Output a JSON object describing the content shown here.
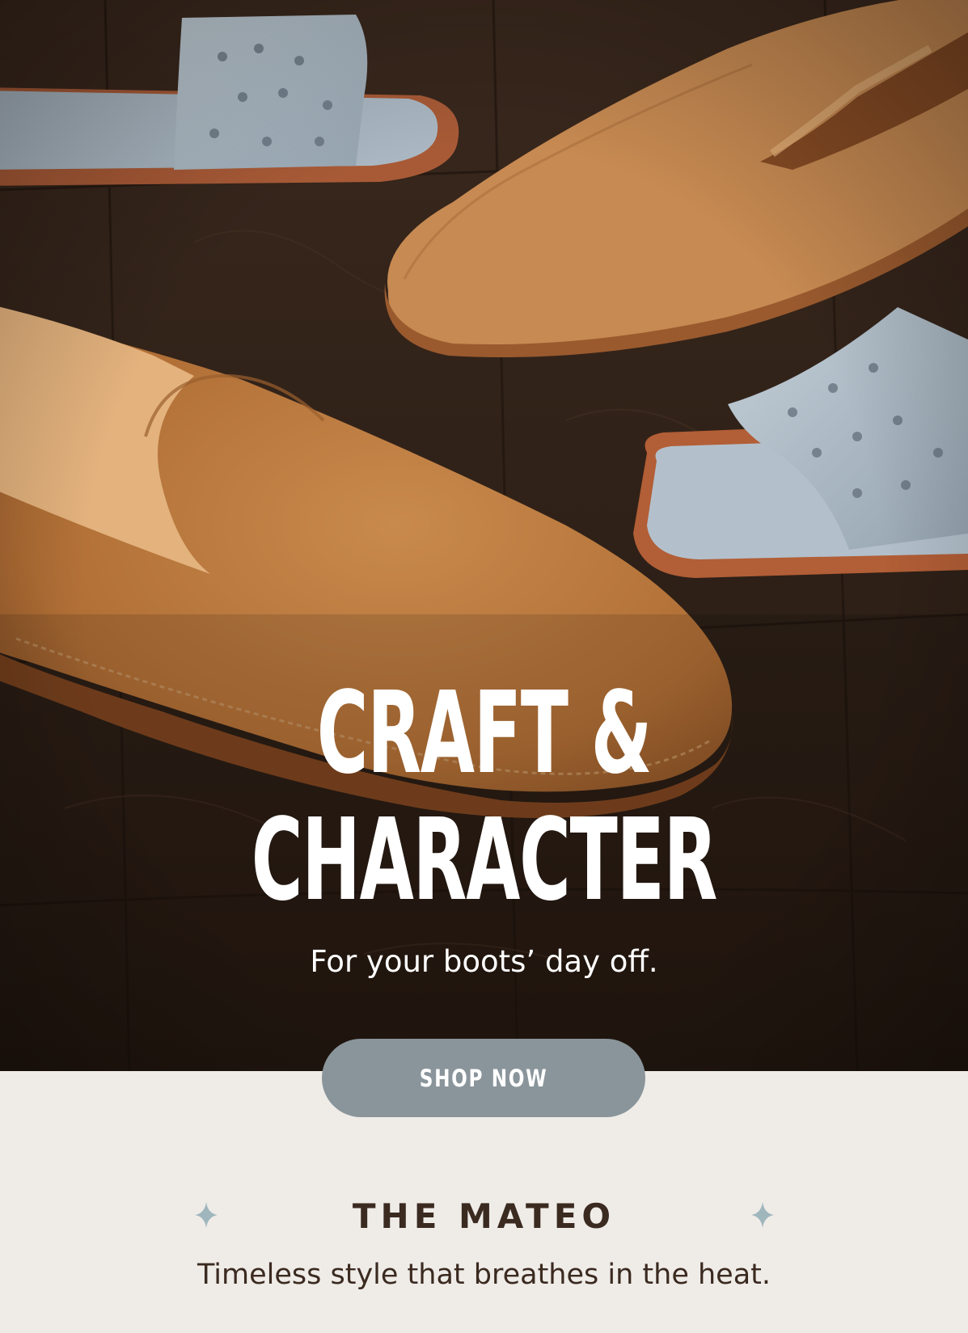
{
  "hero": {
    "headline_line1": "CRAFT &",
    "headline_line2": "CHARACTER",
    "subheadline": "For your boots’ day off.",
    "image_alt": "Tan leather loafers and light blue ostrich-print slide sandals on a dark wood floor"
  },
  "cta": {
    "label": "SHOP NOW"
  },
  "product": {
    "title": "THE MATEO",
    "tagline": "Timeless style that breathes in the heat."
  },
  "colors": {
    "page_background": "#efece8",
    "button_background": "#8a959b",
    "text_dark": "#3b2a20",
    "sparkle_accent": "#9fb6bd",
    "leather_tan": "#b9773e",
    "slide_blue": "#b6c3cc",
    "wood_dark": "#2e2018"
  },
  "icons": {
    "sparkle": "four-point-star-icon"
  }
}
